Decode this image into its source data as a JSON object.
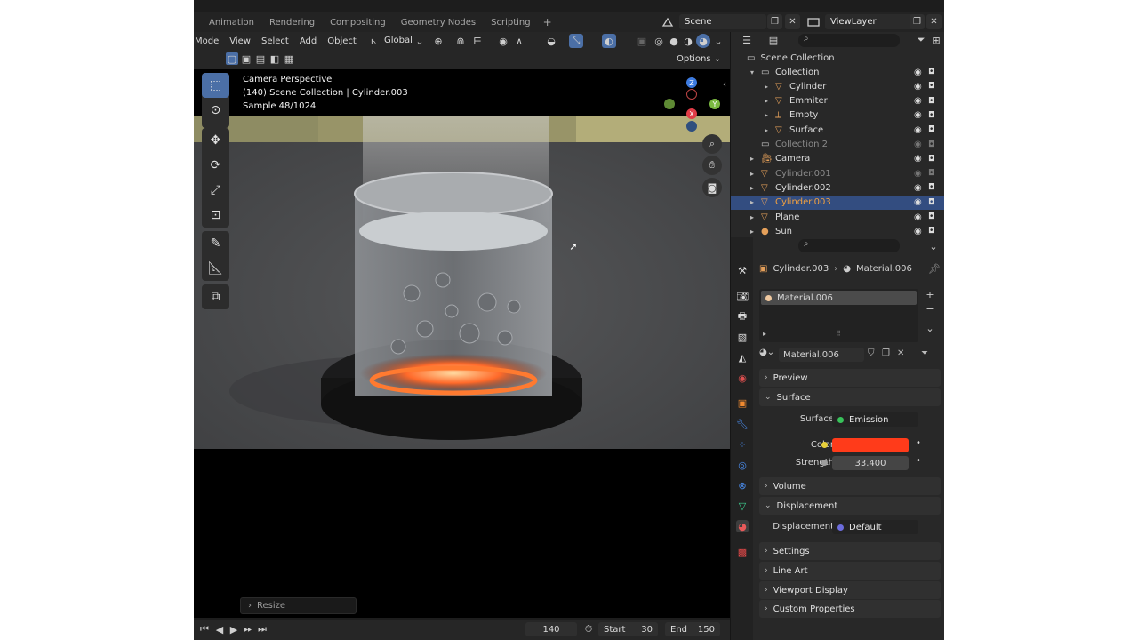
{
  "topbar": {
    "workspaces": [
      "Animation",
      "Rendering",
      "Compositing",
      "Geometry Nodes",
      "Scripting"
    ],
    "add_workspace": "+",
    "scene": "Scene",
    "view_layer": "ViewLayer"
  },
  "viewport_header": {
    "mode": "Mode",
    "menus": [
      "View",
      "Select",
      "Add",
      "Object"
    ],
    "orientation": "Global",
    "options": "Options"
  },
  "viewport": {
    "line1": "Camera Perspective",
    "line2": "(140) Scene Collection | Cylinder.003",
    "line3": "Sample 48/1024",
    "gizmo": {
      "z": "Z",
      "y": "Y",
      "x": "X"
    }
  },
  "operator_panel": {
    "label": "Resize"
  },
  "timeline": {
    "current_frame": "140",
    "start_label": "Start",
    "start": "30",
    "end_label": "End",
    "end": "150"
  },
  "outliner": {
    "root": "Scene Collection",
    "items": [
      {
        "label": "Collection",
        "depth": 1,
        "selected": false,
        "dim": false
      },
      {
        "label": "Cylinder",
        "depth": 2,
        "selected": false,
        "dim": false
      },
      {
        "label": "Emmiter",
        "depth": 2,
        "selected": false,
        "dim": false
      },
      {
        "label": "Empty",
        "depth": 2,
        "selected": false,
        "dim": false
      },
      {
        "label": "Surface",
        "depth": 2,
        "selected": false,
        "dim": false
      },
      {
        "label": "Collection 2",
        "depth": 1,
        "selected": false,
        "dim": true
      },
      {
        "label": "Camera",
        "depth": 1,
        "selected": false,
        "dim": false
      },
      {
        "label": "Cylinder.001",
        "depth": 1,
        "selected": false,
        "dim": true
      },
      {
        "label": "Cylinder.002",
        "depth": 1,
        "selected": false,
        "dim": false
      },
      {
        "label": "Cylinder.003",
        "depth": 1,
        "selected": true,
        "dim": false
      },
      {
        "label": "Plane",
        "depth": 1,
        "selected": false,
        "dim": false
      },
      {
        "label": "Sun",
        "depth": 1,
        "selected": false,
        "dim": false
      }
    ]
  },
  "properties": {
    "object": "Cylinder.003",
    "material": "Material.006",
    "slot": "Material.006",
    "material_field": "Material.006",
    "panels": {
      "preview": "Preview",
      "surface": "Surface",
      "volume": "Volume",
      "displacement": "Displacement",
      "settings": "Settings",
      "line_art": "Line Art",
      "viewport_display": "Viewport Display",
      "custom_properties": "Custom Properties"
    },
    "surface_label": "Surface",
    "surface_value": "Emission",
    "color_label": "Color",
    "color_value": "#ff3b1a",
    "strength_label": "Strength",
    "strength_value": "33.400",
    "displacement_label": "Displacement",
    "displacement_value": "Default"
  }
}
